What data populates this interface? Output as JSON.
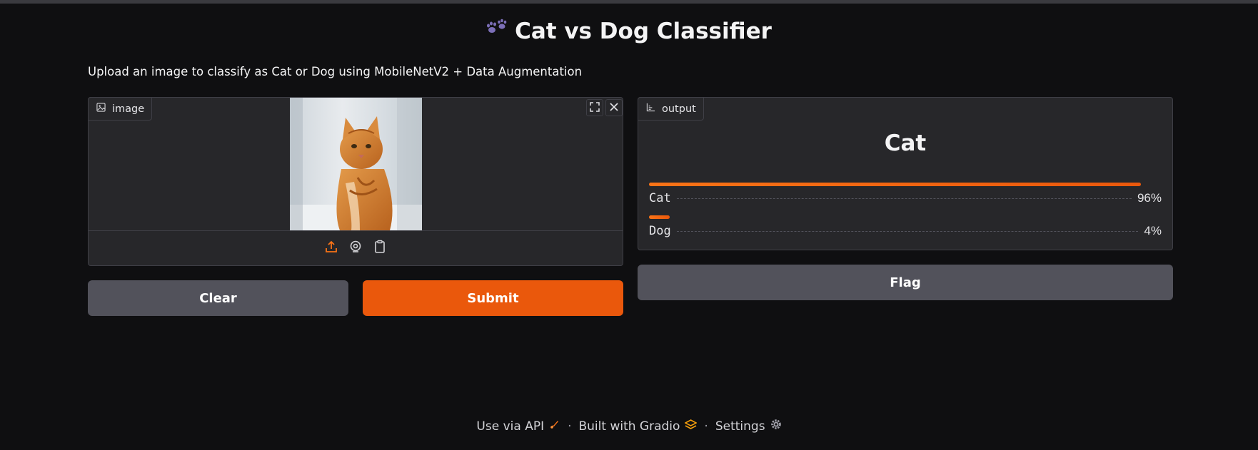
{
  "app": {
    "title": "Cat vs Dog Classifier",
    "title_icon": "paw-prints",
    "description": "Upload an image to classify as Cat or Dog using MobileNetV2 + Data Augmentation"
  },
  "input": {
    "label": "image",
    "label_icon": "image-icon",
    "toolbar_icons": [
      "upload-icon",
      "webcam-icon",
      "clipboard-icon"
    ]
  },
  "output": {
    "label": "output",
    "label_icon": "chart-icon",
    "predicted": "Cat",
    "confidences": [
      {
        "label": "Cat",
        "value": 0.96,
        "display": "96%"
      },
      {
        "label": "Dog",
        "value": 0.04,
        "display": "4%"
      }
    ]
  },
  "buttons": {
    "clear": "Clear",
    "submit": "Submit",
    "flag": "Flag"
  },
  "footer": {
    "api": "Use via API",
    "built": "Built with Gradio",
    "settings": "Settings",
    "separator": "·"
  },
  "colors": {
    "accent": "#ea580c",
    "background": "#0f0f11",
    "panel": "#27272a",
    "secondary_button": "#52525b"
  }
}
